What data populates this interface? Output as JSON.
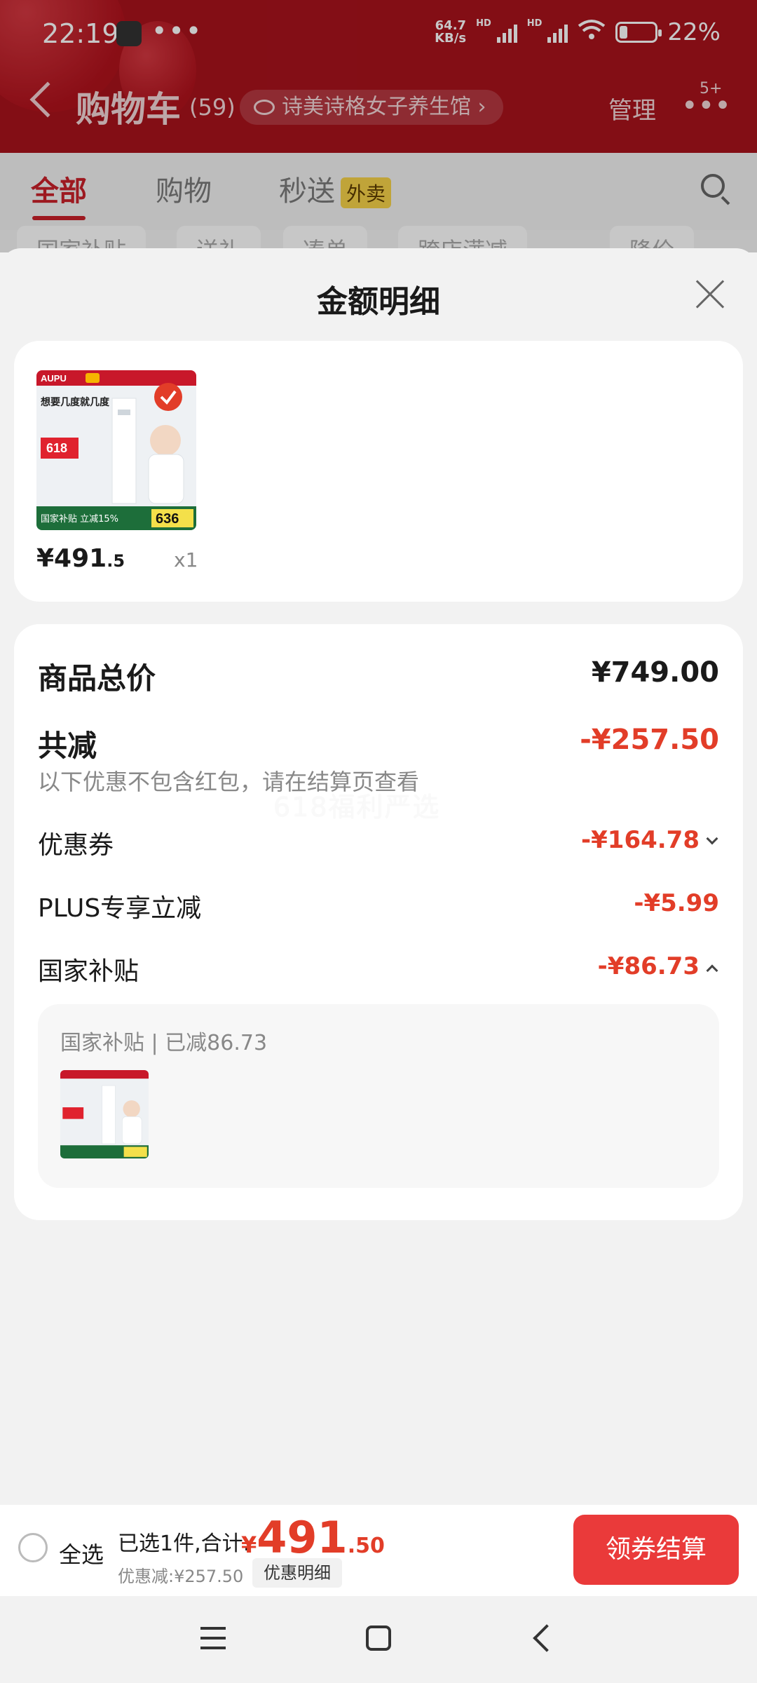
{
  "status_bar": {
    "time": "22:19",
    "more": "•••",
    "net_speed_value": "64.7",
    "net_speed_unit": "KB/s",
    "hd_label": "HD",
    "battery_level": "22%",
    "battery_fraction": 0.22
  },
  "cart_header": {
    "title": "购物车",
    "count": "(59)",
    "shop_name": "诗美诗格女子养生馆",
    "manage": "管理",
    "more_badge": "5+"
  },
  "cart_tabs": [
    {
      "label": "全部",
      "active": true
    },
    {
      "label": "购物",
      "active": false
    },
    {
      "label": "秒送",
      "active": false,
      "tag": "外卖"
    }
  ],
  "filter_chips": [
    "国家补贴",
    "送礼",
    "凑单",
    "跨店满减",
    "降价"
  ],
  "sheet": {
    "title": "金额明细",
    "product": {
      "brand": "AUPU",
      "price_int": "¥491",
      "price_dec": ".5",
      "qty": "x1",
      "image_texts": [
        "想要几度就几度",
        "618",
        "国家补贴 立减15%",
        "636"
      ]
    },
    "summary": {
      "total_label": "商品总价",
      "total_value": "¥749.00",
      "reduce_label": "共减",
      "reduce_value": "-¥257.50",
      "hint": "以下优惠不包含红包，请在结算页查看",
      "watermark": "618福利严选",
      "items": [
        {
          "label": "优惠券",
          "value": "-¥164.78",
          "chevron": "down"
        },
        {
          "label": "PLUS专享立减",
          "value": "-¥5.99",
          "chevron": ""
        },
        {
          "label": "国家补贴",
          "value": "-¥86.73",
          "chevron": "up"
        }
      ],
      "subsidy_panel": {
        "title": "国家补贴 | 已减86.73"
      }
    }
  },
  "checkout": {
    "select_all": "全选",
    "selected_info": "已选1件,合计:",
    "total_yen": "¥",
    "total_int": "491",
    "total_dec": ".50",
    "discount": "优惠减:¥257.50",
    "detail_button": "优惠明细",
    "pay_button": "领券结算"
  },
  "colors": {
    "accent_red": "#e23d28",
    "header_red": "#a8121c",
    "pay_button": "#ea3a3a"
  }
}
